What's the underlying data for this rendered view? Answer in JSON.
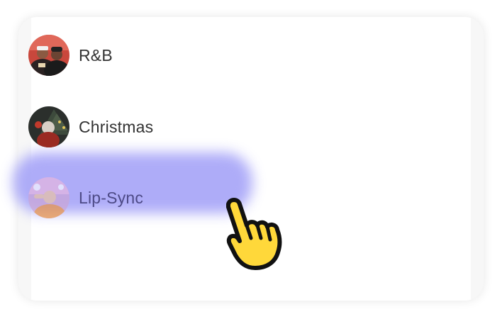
{
  "list": {
    "items": [
      {
        "label": "R&B",
        "icon": "rnb-avatar-icon"
      },
      {
        "label": "Christmas",
        "icon": "christmas-avatar-icon"
      },
      {
        "label": "Lip-Sync",
        "icon": "lip-sync-avatar-icon",
        "active": true
      }
    ]
  },
  "colors": {
    "highlight": "#aaa8f8",
    "hand_fill": "#ffd83a",
    "hand_outline": "#111111"
  },
  "cursor": {
    "icon": "pointing-hand-icon"
  }
}
